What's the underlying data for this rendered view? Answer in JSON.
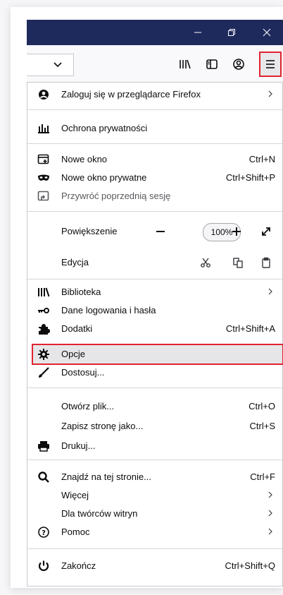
{
  "menu": {
    "sign_in": "Zaloguj się w przeglądarce Firefox",
    "privacy": "Ochrona prywatności",
    "new_window": "Nowe okno",
    "new_window_shortcut": "Ctrl+N",
    "new_private_window": "Nowe okno prywatne",
    "new_private_window_shortcut": "Ctrl+Shift+P",
    "restore_session": "Przywróć poprzednią sesję",
    "zoom_label": "Powiększenie",
    "zoom_minus": "—",
    "zoom_value": "100%",
    "zoom_plus": "+",
    "edit_label": "Edycja",
    "library": "Biblioteka",
    "logins": "Dane logowania i hasła",
    "addons": "Dodatki",
    "addons_shortcut": "Ctrl+Shift+A",
    "options": "Opcje",
    "customize": "Dostosuj...",
    "open_file": "Otwórz plik...",
    "open_file_shortcut": "Ctrl+O",
    "save_page": "Zapisz stronę jako...",
    "save_page_shortcut": "Ctrl+S",
    "print": "Drukuj...",
    "find": "Znajdź na tej stronie...",
    "find_shortcut": "Ctrl+F",
    "more": "Więcej",
    "web_developer": "Dla twórców witryn",
    "help": "Pomoc",
    "quit": "Zakończ",
    "quit_shortcut": "Ctrl+Shift+Q",
    "submenu_arrow": ">"
  },
  "colors": {
    "titlebar": "#1f2a5c",
    "highlight_border": "#e0232e"
  },
  "icons": [
    "chevron-down-icon",
    "library-icon",
    "sidebar-icon",
    "account-icon",
    "hamburger-menu-icon",
    "minimize-icon",
    "restore-icon",
    "close-icon",
    "user-circle-icon",
    "privacy-chart-icon",
    "new-window-icon",
    "private-mask-icon",
    "restore-session-icon",
    "fullscreen-icon",
    "cut-icon",
    "copy-icon",
    "paste-icon",
    "key-icon",
    "puzzle-icon",
    "gear-icon",
    "brush-icon",
    "printer-icon",
    "search-icon",
    "help-icon",
    "power-icon"
  ]
}
